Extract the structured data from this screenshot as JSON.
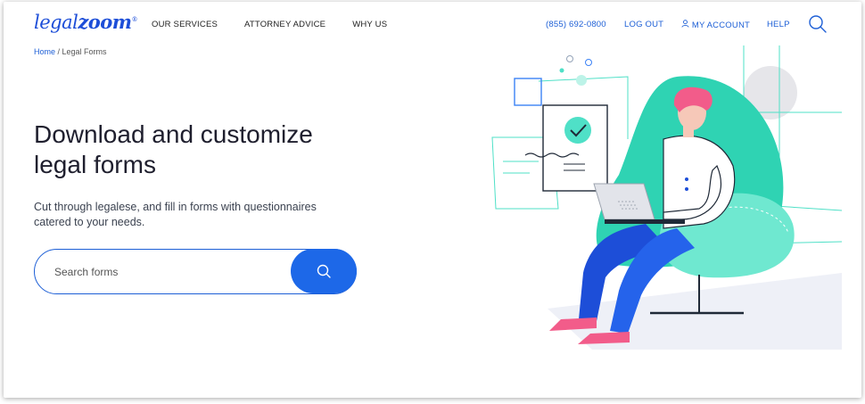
{
  "brand": {
    "logo_part1": "legal",
    "logo_part2": "zoom",
    "logo_mark": "®"
  },
  "nav": {
    "primary": [
      "OUR SERVICES",
      "ATTORNEY ADVICE",
      "WHY US"
    ],
    "phone": "(855) 692-0800",
    "logout": "LOG OUT",
    "account": "MY ACCOUNT",
    "help": "HELP"
  },
  "breadcrumb": {
    "home": "Home",
    "separator": " / ",
    "current": "Legal Forms"
  },
  "hero": {
    "title": "Download and customize legal forms",
    "subtitle": "Cut through legalese, and fill in forms with questionnaires catered to your needs."
  },
  "search": {
    "placeholder": "Search forms",
    "value": ""
  },
  "icons": {
    "search_top": "search-icon",
    "account": "user-icon",
    "search_button": "search-icon"
  },
  "colors": {
    "brand_blue": "#1d4ed8",
    "link_blue": "#1d5fd6",
    "button_blue": "#1d68e8",
    "teal": "#4fe0c7",
    "pink": "#f25c8a"
  }
}
